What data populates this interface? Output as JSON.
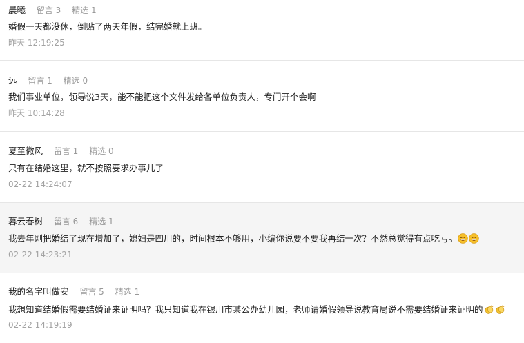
{
  "comments": [
    {
      "user": "晨曦",
      "replies": "留言 3",
      "picks": "精选 1",
      "text": "婚假一天都没休，倒贴了两天年假，结完婚就上班。",
      "time": "昨天 12:19:25"
    },
    {
      "user": "远",
      "replies": "留言 1",
      "picks": "精选 0",
      "text": "我们事业单位，领导说3天，能不能把这个文件发给各单位负责人，专门开个会啊",
      "time": "昨天 10:14:28"
    },
    {
      "user": "夏至微风",
      "replies": "留言 1",
      "picks": "精选 0",
      "text": "只有在结婚这里，就不按照要求办事儿了",
      "time": "02-22 14:24:07"
    },
    {
      "user": "暮云春树",
      "replies": "留言 6",
      "picks": "精选 1",
      "text": "我去年刚把婚结了现在增加了，媳妇是四川的，时间根本不够用，小编你说要不要我再结一次？不然总觉得有点吃亏。",
      "emojis": [
        "grin-emoji",
        "grin-emoji"
      ],
      "time": "02-22 14:23:21"
    },
    {
      "user": "我的名字叫做安",
      "replies": "留言 5",
      "picks": "精选 1",
      "text": "我想知道结婚假需要结婚证来证明吗？我只知道我在银川市某公办幼儿园，老师请婚假领导说教育局说不需要结婚证来证明的",
      "emojis": [
        "clap-emoji",
        "clap-emoji"
      ],
      "time": "02-22 14:19:19"
    }
  ],
  "colors": {
    "username": "#222222",
    "stat": "#999999",
    "body": "#222222",
    "time": "#a3a3a3",
    "highlight_bg": "#f5f5f5",
    "divider": "#e6e6e6"
  }
}
